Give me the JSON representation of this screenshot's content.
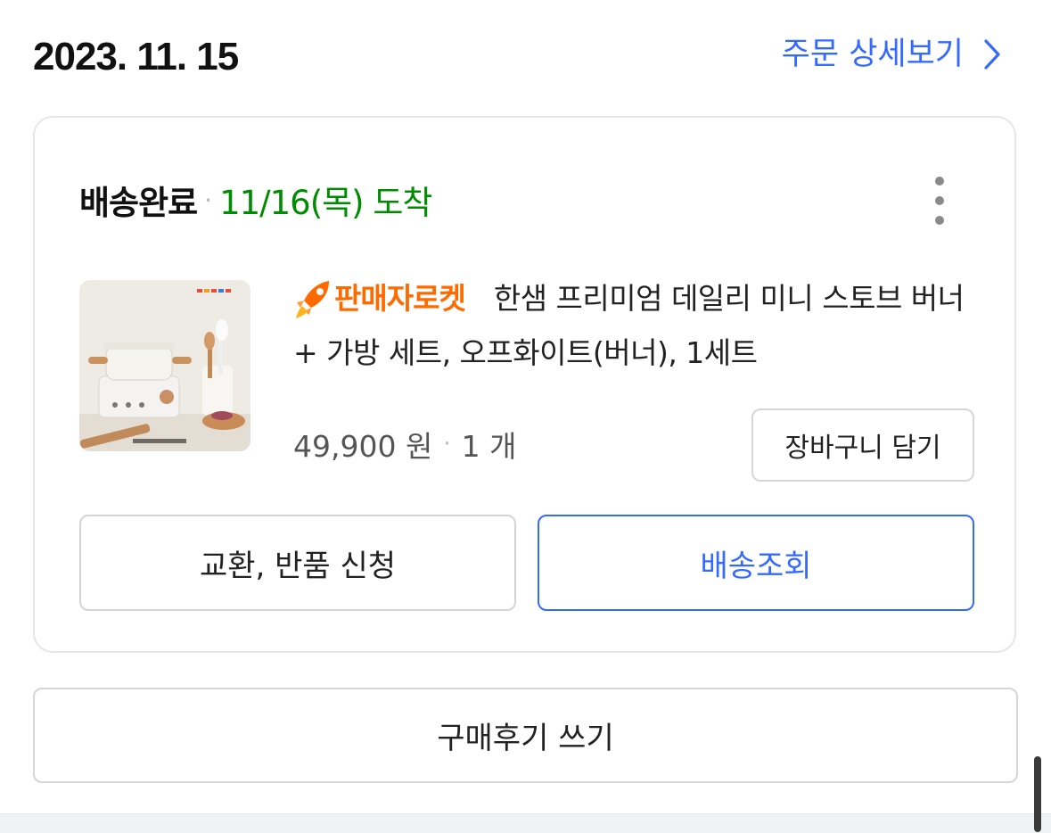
{
  "order": {
    "date": "2023. 11. 15",
    "detail_link_label": "주문 상세보기",
    "detail_link_icon": "chevron-right-icon"
  },
  "delivery": {
    "status": "배송완료",
    "separator": "·",
    "arrival": "11/16(목) 도착",
    "more_icon": "kebab-menu-icon"
  },
  "product": {
    "badge_icon": "rocket-icon",
    "badge_label": "판매자로켓",
    "name": "한샘 프리미엄 데일리 미니 스토브 버너 + 가방 세트, 오프화이트(버너), 1세트",
    "price": "49,900 원",
    "separator": "·",
    "quantity": "1 개",
    "image_icon": "product-photo-stove-set"
  },
  "buttons": {
    "add_to_cart": "장바구니 담기",
    "exchange_return": "교환, 반품 신청",
    "track_delivery": "배송조회",
    "write_review": "구매후기 쓰기"
  },
  "colors": {
    "accent_blue": "#346aff",
    "arrival_green": "#008c00",
    "rocket_orange": "#ff6a00"
  }
}
